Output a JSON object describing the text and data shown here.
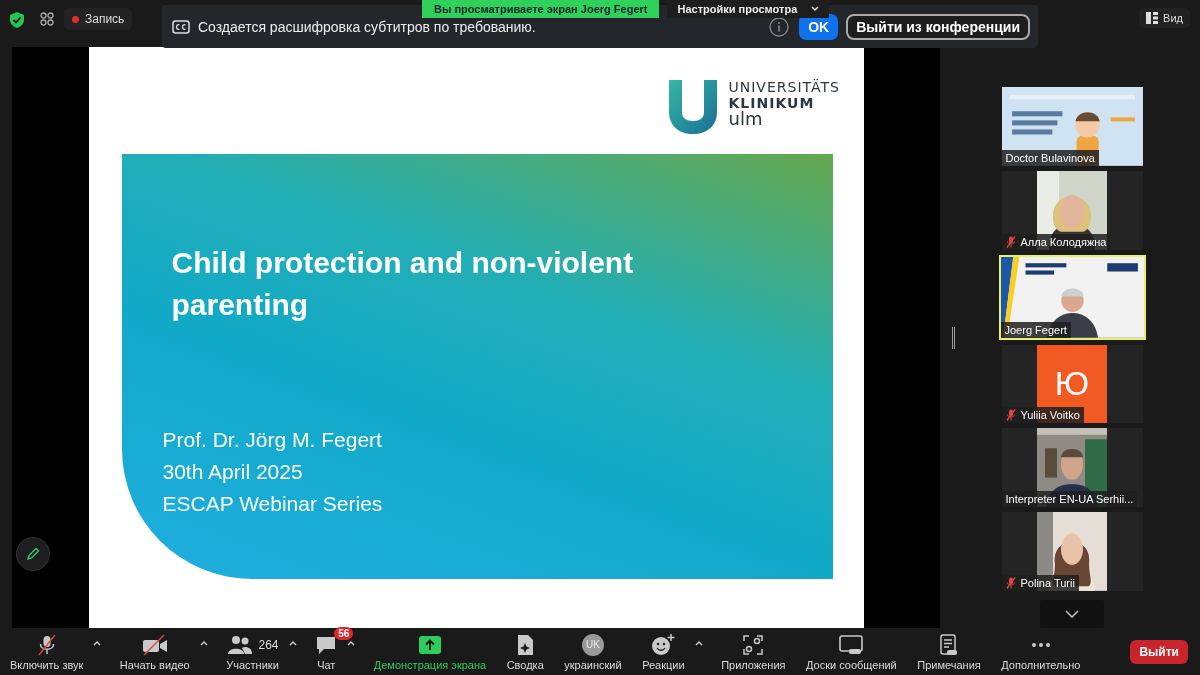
{
  "top_bar": {
    "recording_label": "Запись",
    "view_button": "Вид"
  },
  "share_banner": {
    "text": "Вы просматриваете экран Joerg Fegert",
    "view_options": "Настройки просмотра"
  },
  "notification": {
    "text": "Создается расшифровка субтитров по требованию.",
    "ok_button": "OK",
    "leave_button": "Выйти из конференции"
  },
  "slide": {
    "logo": [
      "UNIVERSITÄTS",
      "KLINIKUM",
      "ulm"
    ],
    "title": "Child protection and non-violent parenting",
    "details": [
      "Prof. Dr. Jörg M. Fegert",
      "30th April 2025",
      "ESCAP Webinar Series"
    ]
  },
  "participants": [
    {
      "name": "Doctor Bulavinova",
      "kind": "poster",
      "muted": false,
      "selected": false
    },
    {
      "name": "Алла Колодяжна",
      "kind": "video",
      "muted": true,
      "selected": false
    },
    {
      "name": "Joerg Fegert",
      "kind": "poster",
      "muted": false,
      "selected": true
    },
    {
      "name": "Yuliia Voitko",
      "kind": "avatar",
      "initial": "Ю",
      "muted": true,
      "selected": false
    },
    {
      "name": "Interpreter EN-UA Serhii...",
      "kind": "video",
      "muted": false,
      "selected": false
    },
    {
      "name": "Polina Turii",
      "kind": "video",
      "muted": true,
      "selected": false
    }
  ],
  "toolbar": [
    {
      "label": "Включить звук",
      "kind": "mic",
      "caret": true,
      "active": false
    },
    {
      "label": "Начать видео",
      "kind": "camera",
      "caret": true,
      "active": false
    },
    {
      "label": "Участники",
      "kind": "participants",
      "count": "264",
      "caret": true,
      "active": false
    },
    {
      "label": "Чат",
      "kind": "chat",
      "badge": "56",
      "caret": true,
      "active": false
    },
    {
      "label": "Демонстрация экрана",
      "kind": "share",
      "caret": false,
      "active": true
    },
    {
      "label": "Сводка",
      "kind": "summary",
      "caret": false,
      "active": false
    },
    {
      "label": "украинский",
      "kind": "language",
      "initials": "UK",
      "caret": false,
      "active": false
    },
    {
      "label": "Реакции",
      "kind": "reactions",
      "caret": true,
      "active": false
    },
    {
      "label": "Приложения",
      "kind": "apps",
      "caret": false,
      "active": false
    },
    {
      "label": "Доски сообщений",
      "kind": "whiteboards",
      "caret": false,
      "active": false
    },
    {
      "label": "Примечания",
      "kind": "notes",
      "caret": false,
      "active": false
    },
    {
      "label": "Дополнительно",
      "kind": "more",
      "caret": false,
      "active": false
    }
  ],
  "leave_button": "Выйти"
}
